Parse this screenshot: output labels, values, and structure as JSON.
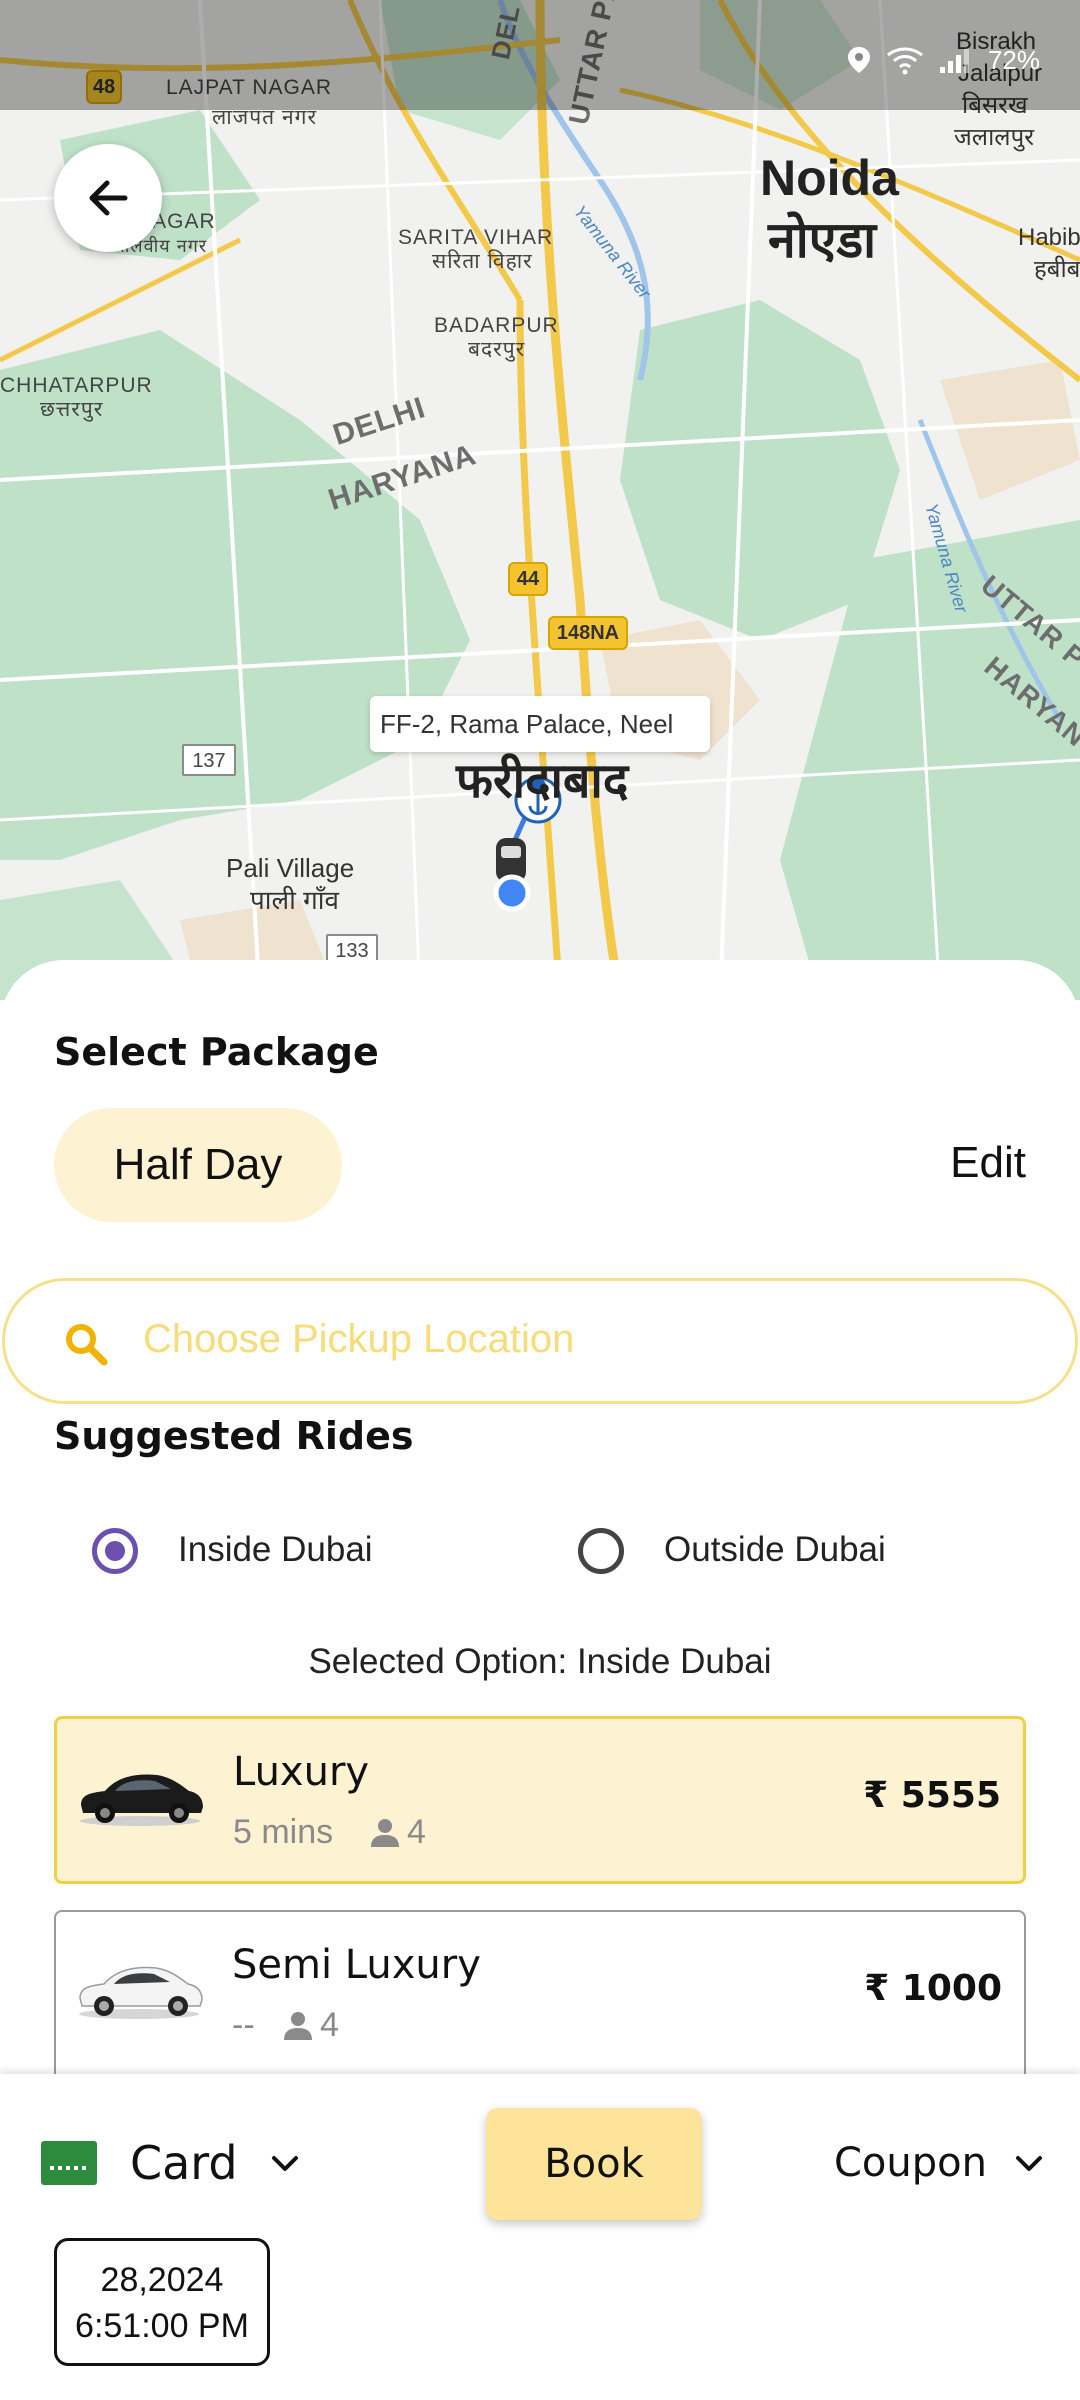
{
  "status_bar": {
    "battery": "72%"
  },
  "map": {
    "labels": {
      "lajpat_nagar": "LAJPAT NAGAR",
      "lajpat_nagar_hi": "लाजपत नगर",
      "malviya_nagar": "NAGAR",
      "malviya_nagar_hi": "मालवीय नगर",
      "sarita_vihar": "SARITA VIHAR",
      "sarita_vihar_hi": "सरिता विहार",
      "badarpur": "BADARPUR",
      "badarpur_hi": "बदरपुर",
      "chhatarpur": "CHHATARPUR",
      "chhatarpur_hi": "छत्तरपुर",
      "noida": "Noida",
      "noida_hi": "नोएडा",
      "bisrakh": "Bisrakh",
      "jalalpur": "Jalalpur",
      "bisrakh_hi": "बिसरख",
      "jalalpur_hi": "जलालपुर",
      "habib": "Habib",
      "habib_hi": "हबीब",
      "delhi": "DELHI",
      "haryana": "HARYANA",
      "uttar_pradesh_top": "UTTAR PR",
      "uttar_pradesh": "UTTAR P",
      "haryana_right": "HARYAN",
      "yamuna_river_1": "Yamuna River",
      "yamuna_river_2": "Yamuna River",
      "faridabad": "फरीदाबाद",
      "pali_village": "Pali Village",
      "pali_village_hi": "पाली गाँव",
      "dl": "DEL"
    },
    "shields": {
      "nh48": "48",
      "nh44": "44",
      "nh148na": "148NA",
      "r137": "137",
      "r133": "133"
    },
    "pickup_pin_label": "FF-2, Rama Palace, Neel"
  },
  "colors": {
    "accent_yellow": "#fde49a",
    "chip_bg": "#fdf3d3",
    "radio_purple": "#6c4fae",
    "card_border": "#f2cf42"
  },
  "package": {
    "section_title": "Select Package",
    "selected": "Half Day",
    "edit_label": "Edit"
  },
  "search": {
    "placeholder": "Choose Pickup Location"
  },
  "suggested": {
    "section_title": "Suggested Rides",
    "options": [
      {
        "label": "Inside Dubai",
        "selected": true
      },
      {
        "label": "Outside Dubai",
        "selected": false
      }
    ],
    "selected_option_text": "Selected Option: Inside Dubai"
  },
  "rides": [
    {
      "name": "Luxury",
      "eta": "5 mins",
      "seats": "4",
      "price": "₹ 5555",
      "selected": true
    },
    {
      "name": "Semi Luxury",
      "eta": "--",
      "seats": "4",
      "price": "₹ 1000",
      "selected": false
    }
  ],
  "bottom": {
    "payment_label": "Card",
    "book_label": "Book",
    "coupon_label": "Coupon",
    "date_line1": "28,2024",
    "date_line2": "6:51:00 PM"
  }
}
